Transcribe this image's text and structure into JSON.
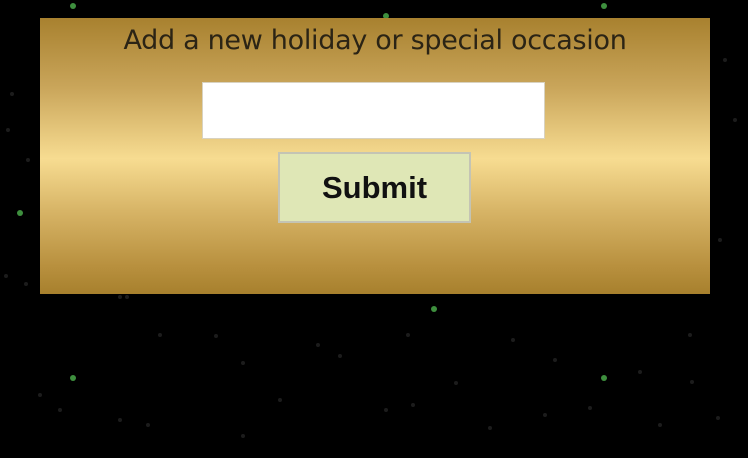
{
  "form": {
    "heading": "Add a new holiday or special occasion",
    "input_value": "",
    "input_placeholder": "",
    "submit_label": "Submit"
  },
  "colors": {
    "page_background": "#000000",
    "panel_gold_dark": "#a8812f",
    "panel_gold_light": "#f7dc91",
    "button_background": "#dfe7b6",
    "star_green": "#4caf50",
    "star_gray": "#1f1f1f"
  }
}
